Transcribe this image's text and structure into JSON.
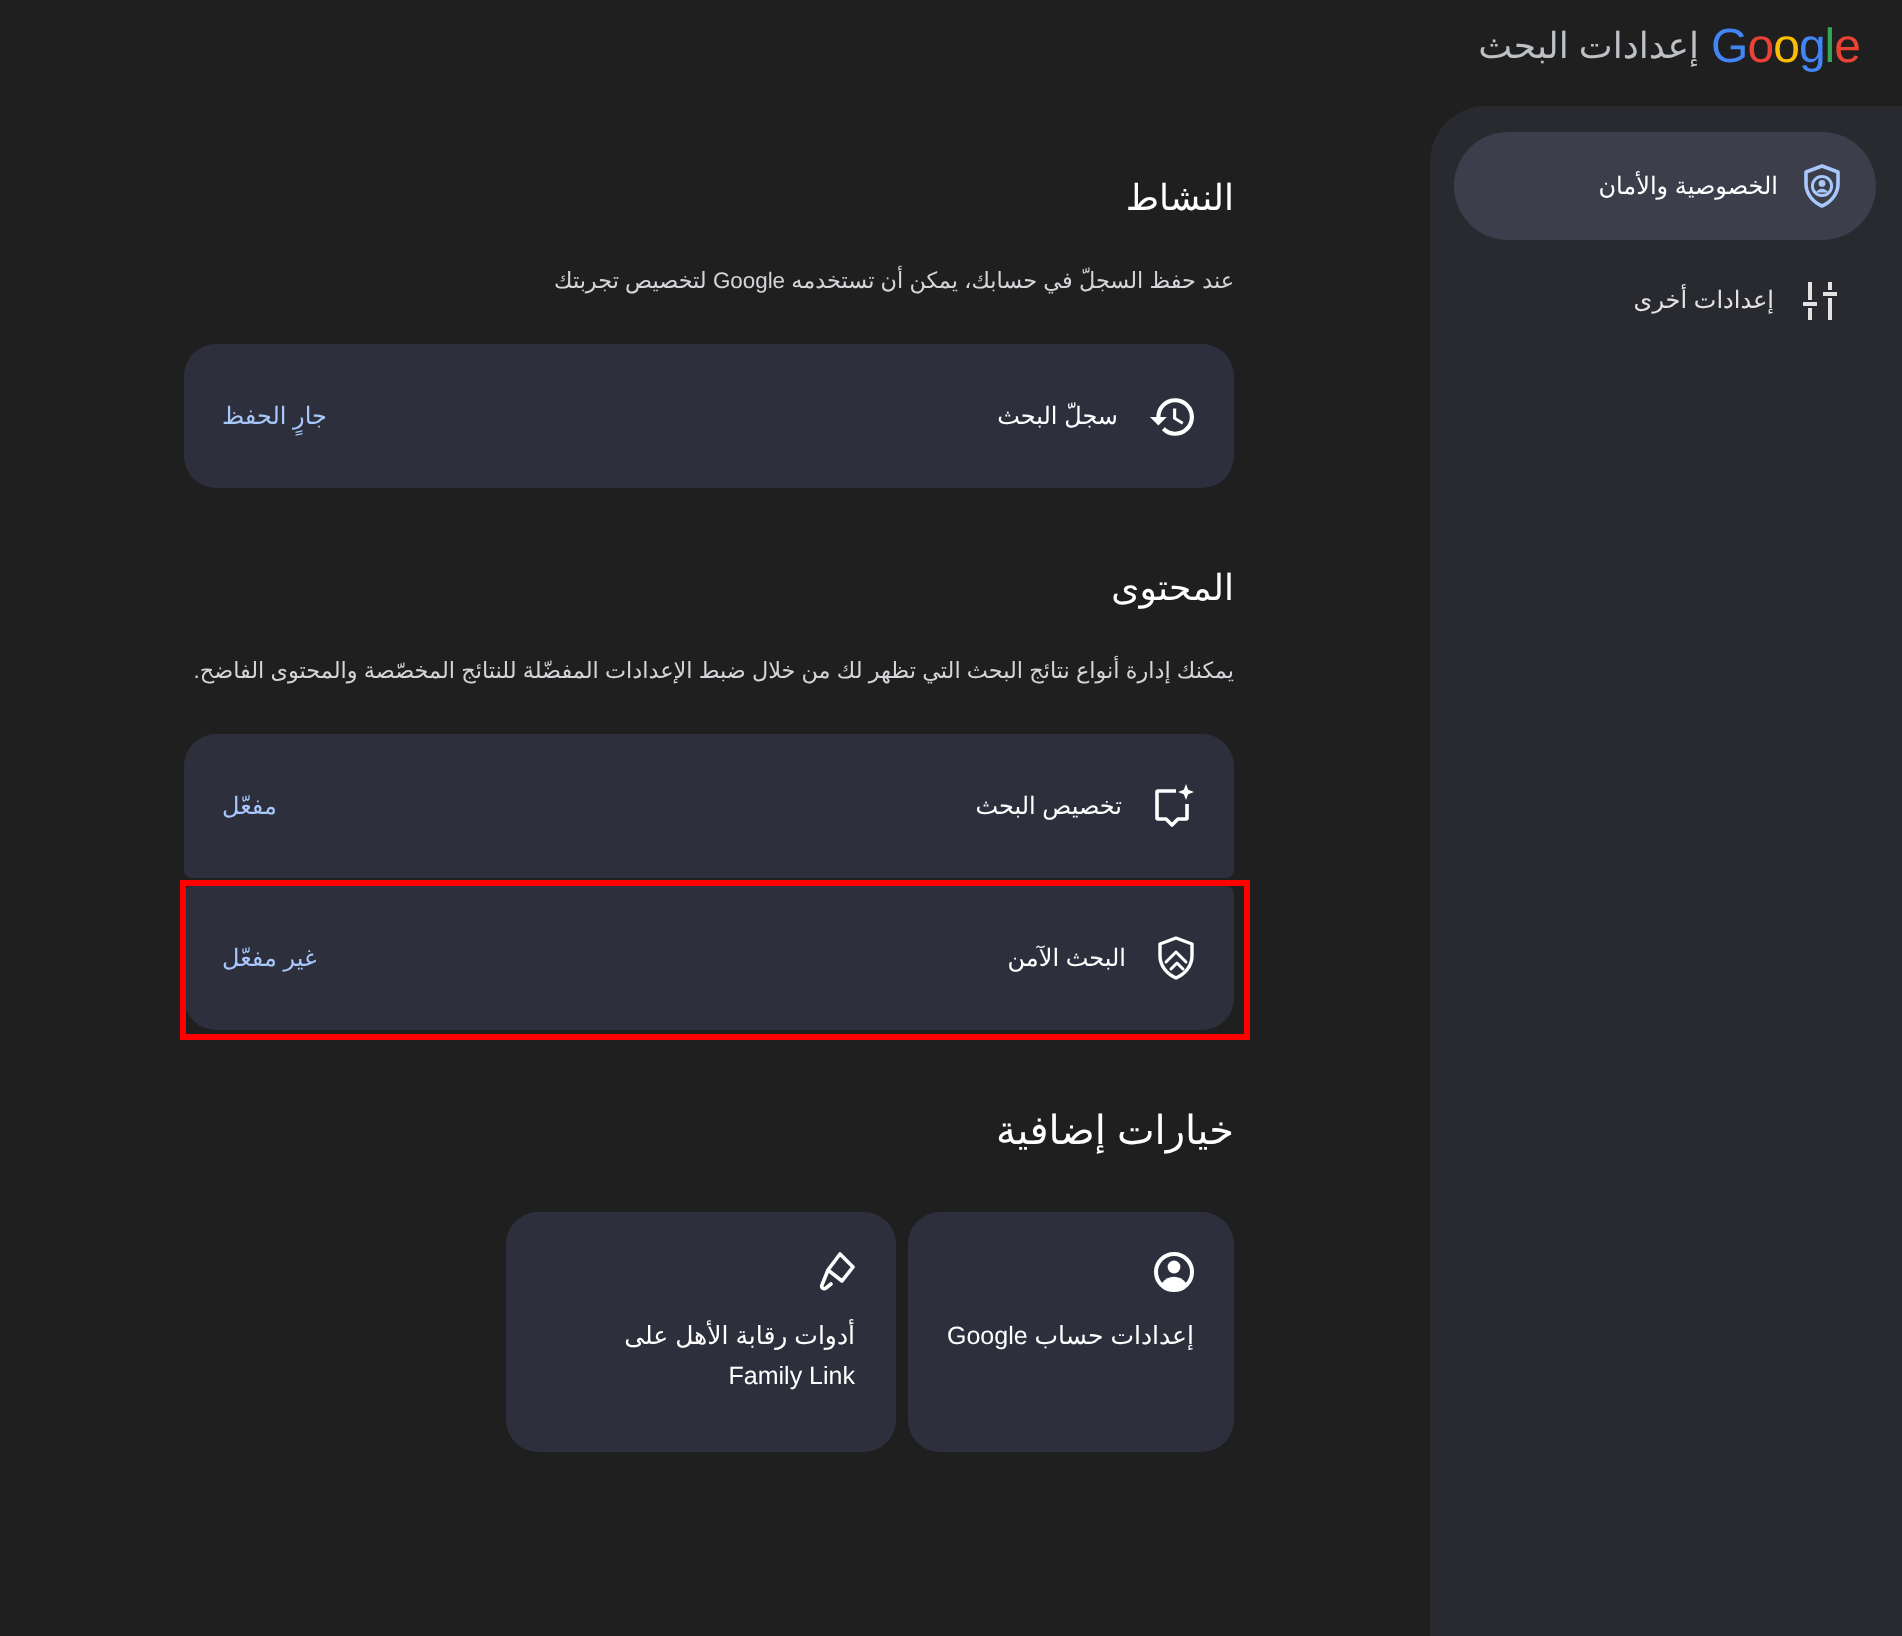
{
  "header": {
    "logo": "Google",
    "title": "إعدادات البحث"
  },
  "sidebar": {
    "items": [
      {
        "label": "الخصوصية والأمان",
        "selected": true
      },
      {
        "label": "إعدادات أخرى",
        "selected": false
      }
    ]
  },
  "sections": [
    {
      "kind": "list",
      "heading": "النشاط",
      "description": "عند حفظ السجلّ في حسابك، يمكن أن تستخدمه Google لتخصيص تجربتك",
      "rows": [
        {
          "label": "سجلّ البحث",
          "value": "جارٍ الحفظ",
          "highlighted": false
        }
      ]
    },
    {
      "kind": "list",
      "heading": "المحتوى",
      "description": "يمكنك إدارة أنواع نتائج البحث التي تظهر لك من خلال ضبط الإعدادات المفضّلة للنتائج المخصّصة والمحتوى الفاضح.",
      "rows": [
        {
          "label": "تخصيص البحث",
          "value": "مفعّل",
          "highlighted": false
        },
        {
          "label": "البحث الآمن",
          "value": "غير مفعّل",
          "highlighted": true
        }
      ]
    },
    {
      "kind": "tiles",
      "heading": "خيارات إضافية",
      "tiles": [
        {
          "label": "إعدادات حساب Google"
        },
        {
          "label": "أدوات رقابة الأهل على Family Link"
        }
      ]
    }
  ]
}
